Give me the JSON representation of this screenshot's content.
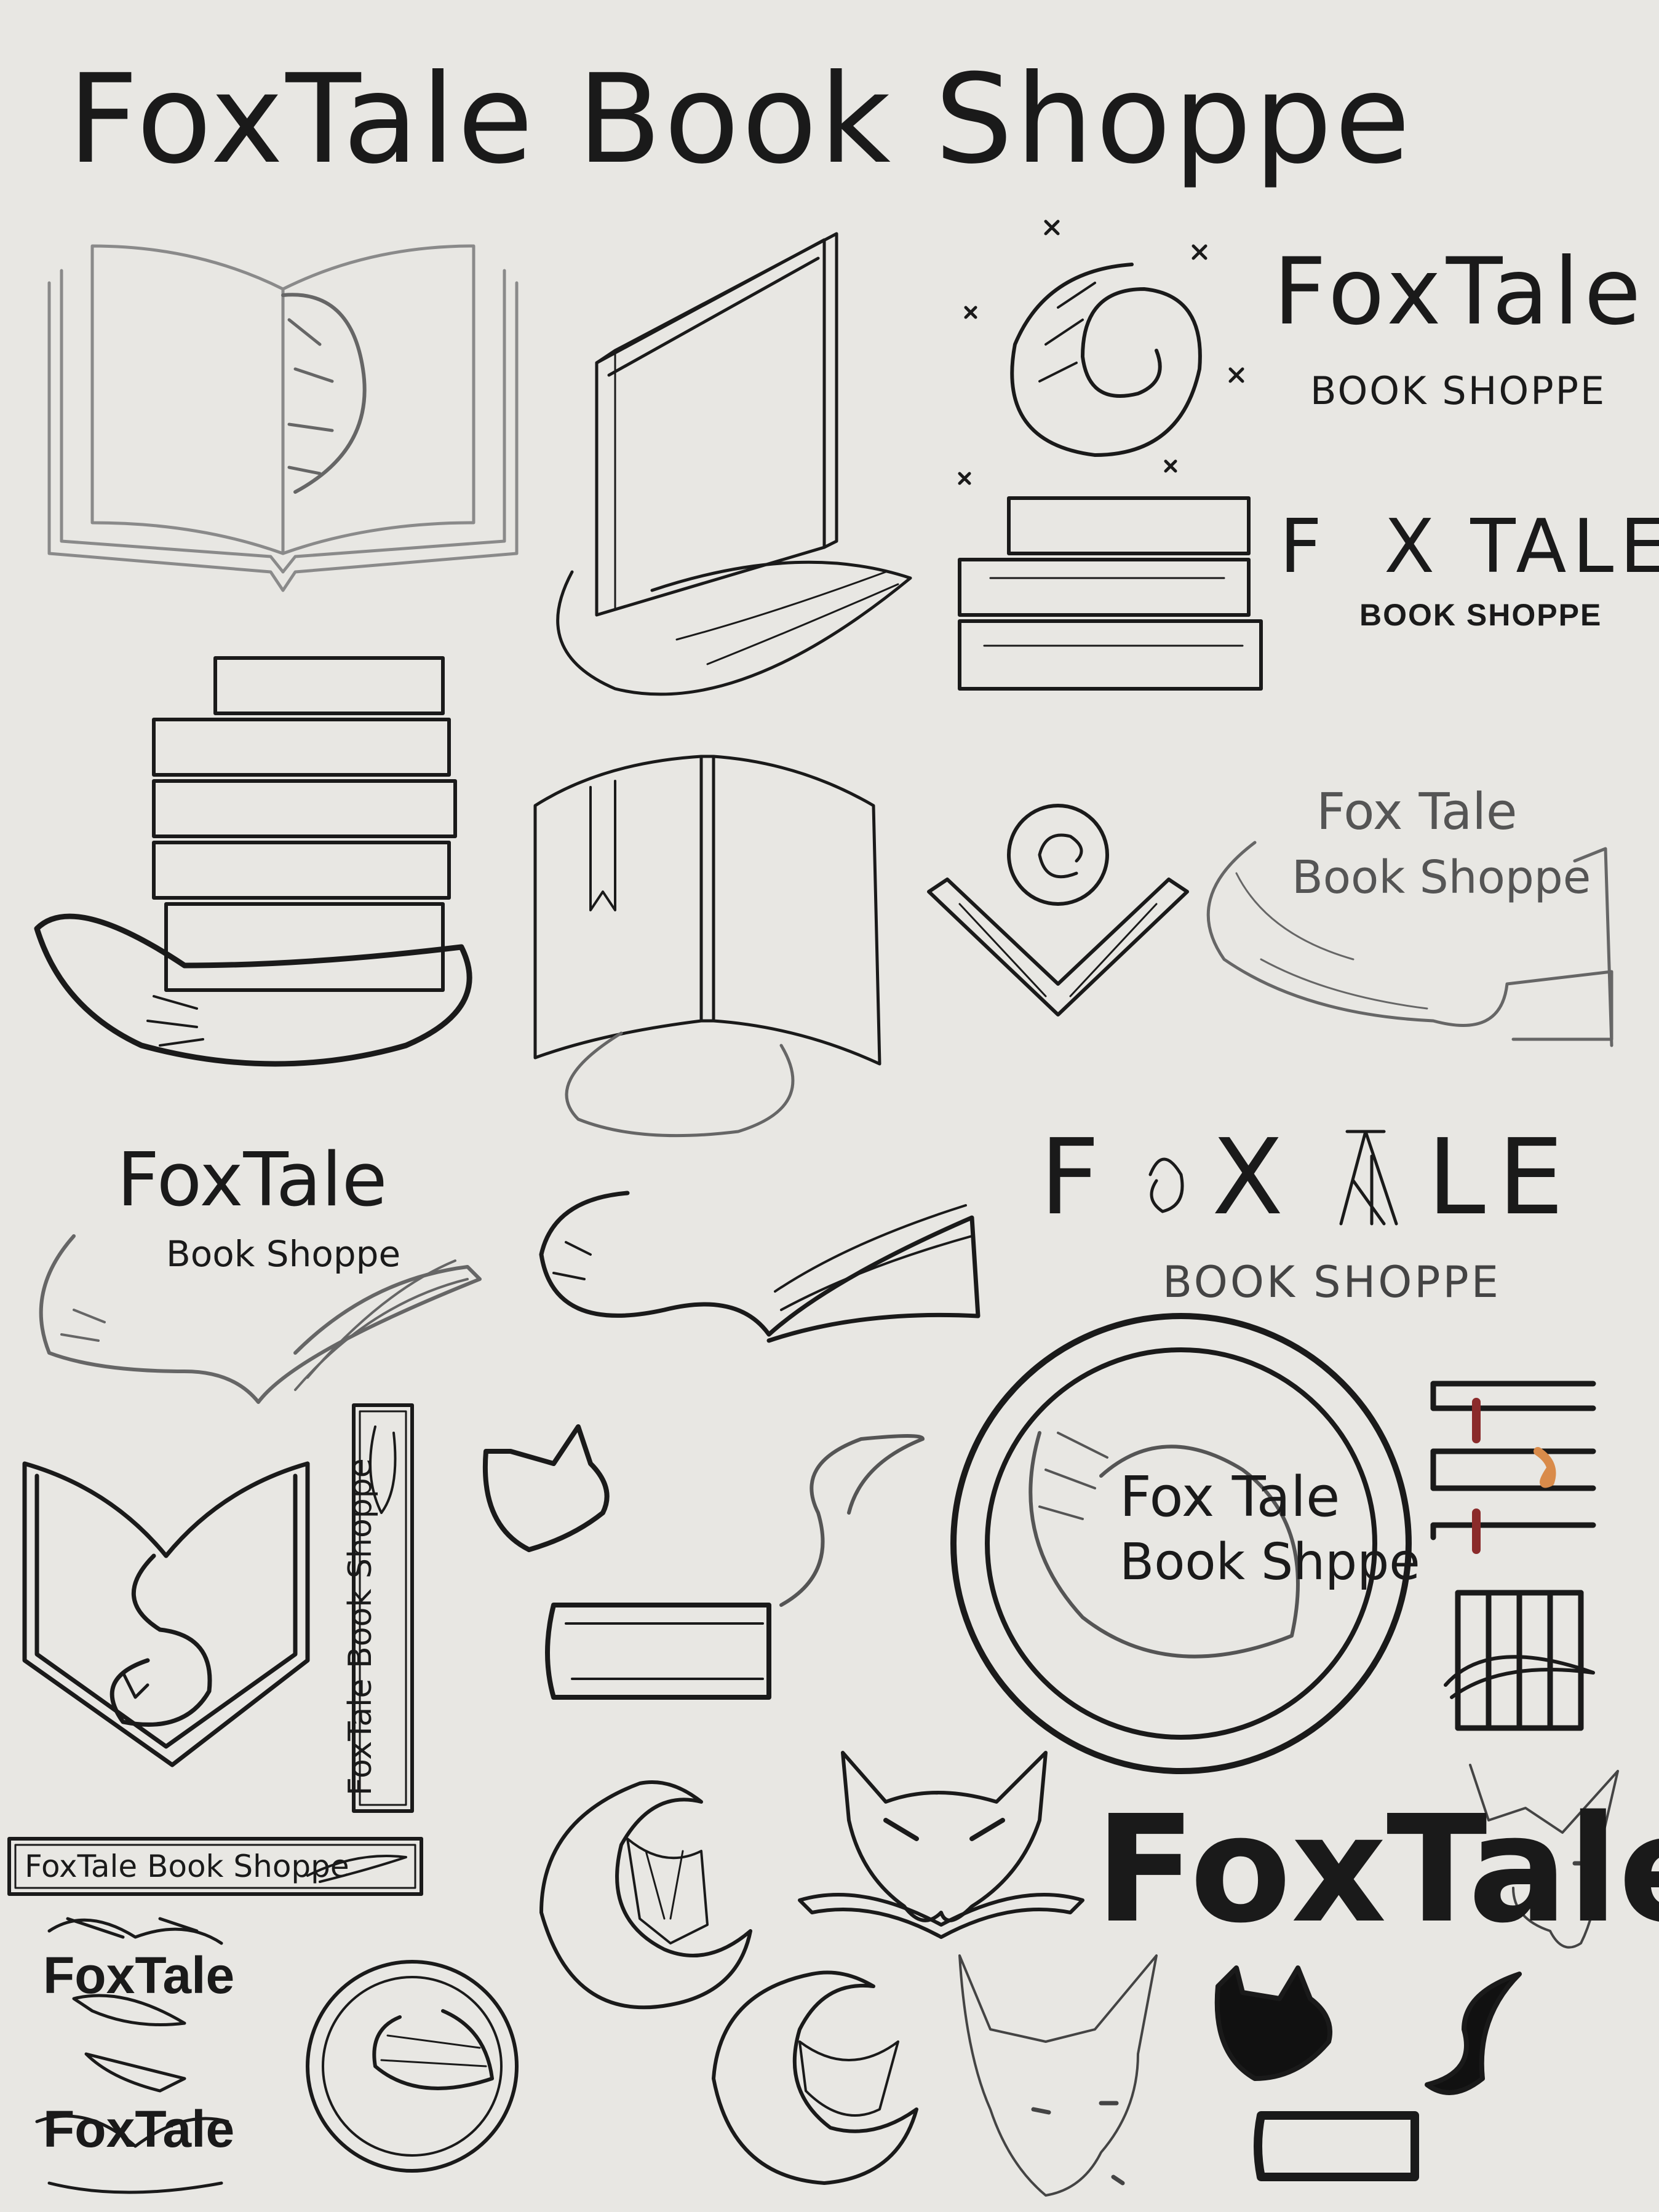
{
  "heading": "FoxTale Book Shoppe",
  "logos": {
    "swirl_wordmark": {
      "name": "FoxTale",
      "sub": "BOOK SHOPPE"
    },
    "stack_wordmark": {
      "name_a": "F",
      "name_b": "X TALE",
      "sub": "BOOK SHOPPE"
    },
    "banner_logo": {
      "line1": "Fox Tale",
      "line2": "Book Shoppe"
    },
    "swoosh_logo": {
      "name": "FoxTale",
      "sub": "Book Shoppe"
    },
    "tall_wordmark": {
      "name_a": "F",
      "name_b": "X",
      "name_c": "LE",
      "sub": "BOOK SHOPPE"
    },
    "ring_logo": {
      "line1": "Fox Tale",
      "line2": "Book Shppe"
    },
    "spine_vertical": "FoxTale Book Shoppe",
    "spine_horizontal": "FoxTale Book Shoppe",
    "small_mark_1": "FoxTale",
    "small_mark_2": "FoxTale",
    "big_wordmark": "FoxTale"
  },
  "colors": {
    "paper": "#e8e7e3",
    "ink": "#1a1a1a",
    "sketch_grey": "#8a8a8a",
    "bookmark_red": "#8b2b2b",
    "fox_orange": "#d98b4a"
  }
}
